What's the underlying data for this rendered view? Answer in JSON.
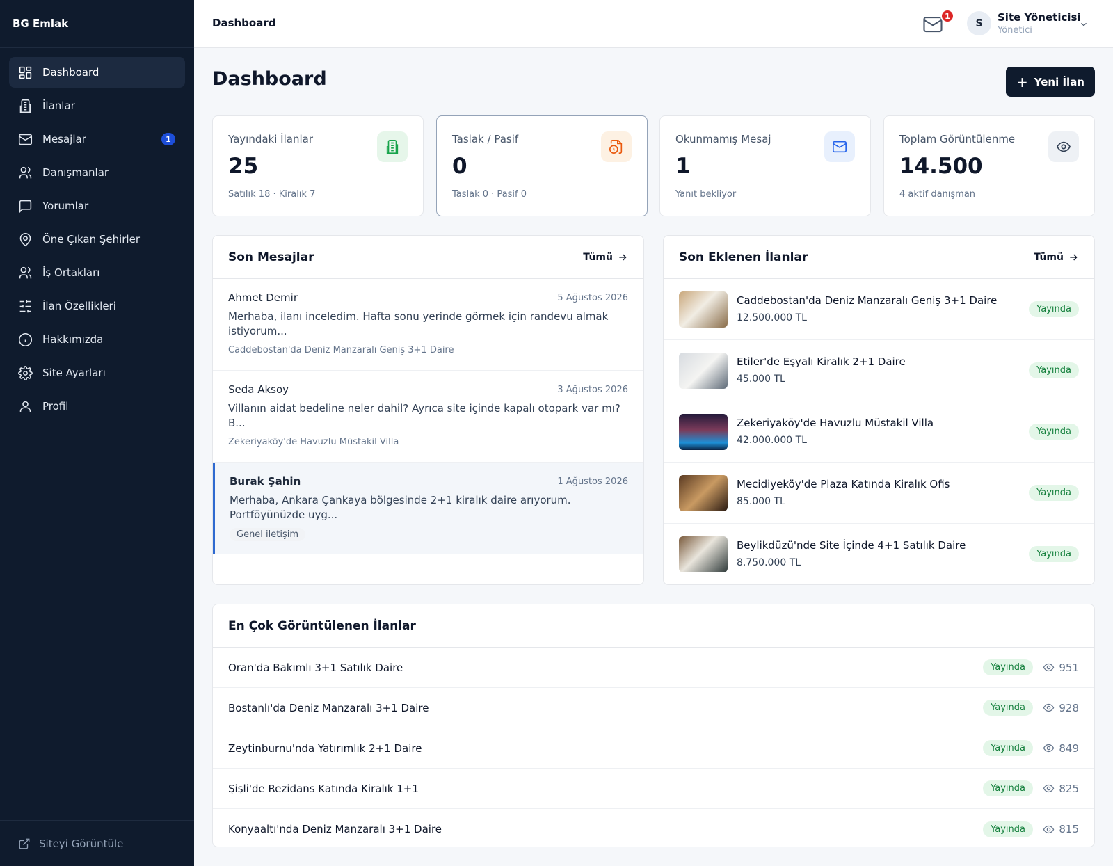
{
  "app": {
    "brand": "BG Emlak"
  },
  "sidebar": {
    "items": [
      {
        "label": "Dashboard",
        "icon": "dashboard-grid-icon"
      },
      {
        "label": "İlanlar",
        "icon": "building-icon"
      },
      {
        "label": "Mesajlar",
        "icon": "mail-icon",
        "badge": "1"
      },
      {
        "label": "Danışmanlar",
        "icon": "users-icon"
      },
      {
        "label": "Yorumlar",
        "icon": "message-square-icon"
      },
      {
        "label": "Öne Çıkan Şehirler",
        "icon": "map-pin-icon"
      },
      {
        "label": "İş Ortakları",
        "icon": "partners-icon"
      },
      {
        "label": "İlan Özellikleri",
        "icon": "sliders-icon"
      },
      {
        "label": "Hakkımızda",
        "icon": "info-icon"
      },
      {
        "label": "Site Ayarları",
        "icon": "gear-icon"
      },
      {
        "label": "Profil",
        "icon": "user-icon"
      }
    ],
    "footer": "Siteyi Görüntüle"
  },
  "header": {
    "breadcrumb": "Dashboard",
    "mail_badge": "1",
    "avatar_initial": "S",
    "user_name": "Site Yöneticisi",
    "user_role": "Yönetici"
  },
  "page": {
    "title": "Dashboard",
    "new_button": "Yeni İlan"
  },
  "stats": [
    {
      "label": "Yayındaki İlanlar",
      "value": "25",
      "sub": "Satılık 18 · Kiralık 7",
      "icon": "building-icon",
      "color": "#16a34a",
      "bg": "#e6f6ea"
    },
    {
      "label": "Taslak / Pasif",
      "value": "0",
      "sub": "Taslak 0 · Pasif 0",
      "icon": "file-clock-icon",
      "color": "#ea580c",
      "bg": "#fdf1e3"
    },
    {
      "label": "Okunmamış Mesaj",
      "value": "1",
      "sub": "Yanıt bekliyor",
      "icon": "mail-icon",
      "color": "#2563eb",
      "bg": "#e8f0fd"
    },
    {
      "label": "Toplam Görüntülenme",
      "value": "14.500",
      "sub": "4 aktif danışman",
      "icon": "eye-icon",
      "color": "#334155",
      "bg": "#eef1f5"
    }
  ],
  "messages": {
    "title": "Son Mesajlar",
    "all_label": "Tümü",
    "items": [
      {
        "name": "Ahmet Demir",
        "date": "5 Ağustos 2026",
        "text": "Merhaba, ilanı inceledim. Hafta sonu yerinde görmek için randevu almak istiyorum...",
        "ref": "Caddebostan'da Deniz Manzaralı Geniş 3+1 Daire"
      },
      {
        "name": "Seda Aksoy",
        "date": "3 Ağustos 2026",
        "text": "Villanın aidat bedeline neler dahil? Ayrıca site içinde kapalı otopark var mı? B...",
        "ref": "Zekeriyaköy'de Havuzlu Müstakil Villa"
      },
      {
        "name": "Burak Şahin",
        "date": "1 Ağustos 2026",
        "text": "Merhaba, Ankara Çankaya bölgesinde 2+1 kiralık daire arıyorum. Portföyünüzde uyg...",
        "tag": "Genel iletişim"
      }
    ]
  },
  "listings": {
    "title": "Son Eklenen İlanlar",
    "all_label": "Tümü",
    "items": [
      {
        "title": "Caddebostan'da Deniz Manzaralı Geniş 3+1 Daire",
        "price": "12.500.000 TL",
        "status": "Yayında"
      },
      {
        "title": "Etiler'de Eşyalı Kiralık 2+1 Daire",
        "price": "45.000 TL",
        "status": "Yayında"
      },
      {
        "title": "Zekeriyaköy'de Havuzlu Müstakil Villa",
        "price": "42.000.000 TL",
        "status": "Yayında"
      },
      {
        "title": "Mecidiyeköy'de Plaza Katında Kiralık Ofis",
        "price": "85.000 TL",
        "status": "Yayında"
      },
      {
        "title": "Beylikdüzü'nde Site İçinde 4+1 Satılık Daire",
        "price": "8.750.000 TL",
        "status": "Yayında"
      }
    ]
  },
  "top_viewed": {
    "title": "En Çok Görüntülenen İlanlar",
    "items": [
      {
        "title": "Oran'da Bakımlı 3+1 Satılık Daire",
        "status": "Yayında",
        "views": "951"
      },
      {
        "title": "Bostanlı'da Deniz Manzaralı 3+1 Daire",
        "status": "Yayında",
        "views": "928"
      },
      {
        "title": "Zeytinburnu'nda Yatırımlık 2+1 Daire",
        "status": "Yayında",
        "views": "849"
      },
      {
        "title": "Şişli'de Rezidans Katında Kiralık 1+1",
        "status": "Yayında",
        "views": "825"
      },
      {
        "title": "Konyaaltı'nda Deniz Manzaralı 3+1 Daire",
        "status": "Yayında",
        "views": "815"
      }
    ]
  },
  "colors": {
    "sidebar_bg": "#0f1b2d",
    "accent": "#1d4ed8",
    "published_green": "#15803d",
    "badge_red": "#dc2626"
  }
}
